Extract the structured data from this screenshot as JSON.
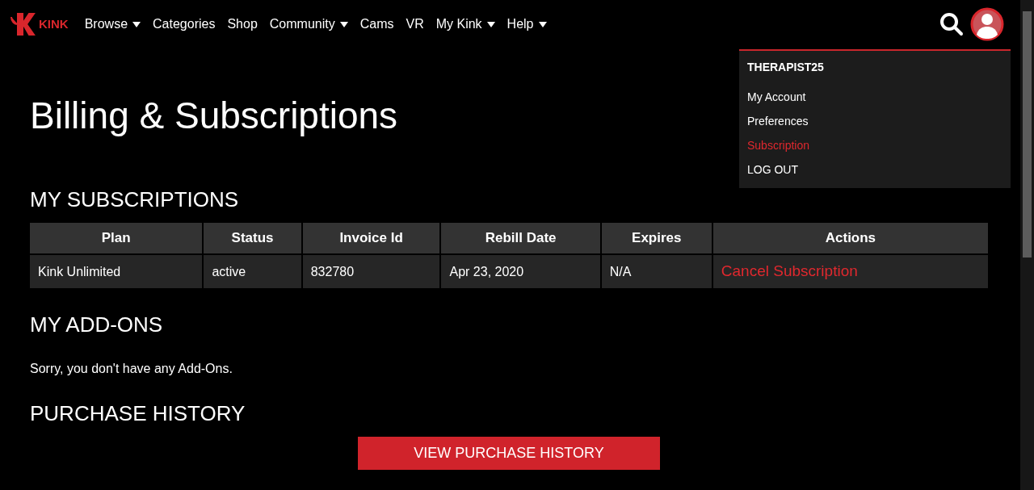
{
  "logo": {
    "text": "KINK"
  },
  "nav": [
    {
      "label": "Browse",
      "dropdown": true
    },
    {
      "label": "Categories",
      "dropdown": false
    },
    {
      "label": "Shop",
      "dropdown": false
    },
    {
      "label": "Community",
      "dropdown": true
    },
    {
      "label": "Cams",
      "dropdown": false
    },
    {
      "label": "VR",
      "dropdown": false
    },
    {
      "label": "My Kink",
      "dropdown": true
    },
    {
      "label": "Help",
      "dropdown": true
    }
  ],
  "user_menu": {
    "username": "THERAPIST25",
    "items": [
      {
        "label": "My Account",
        "selected": false
      },
      {
        "label": "Preferences",
        "selected": false
      },
      {
        "label": "Subscription",
        "selected": true
      },
      {
        "label": "LOG OUT",
        "selected": false
      }
    ]
  },
  "title": "Billing & Subscriptions",
  "subscriptions": {
    "heading": "MY SUBSCRIPTIONS",
    "columns": [
      "Plan",
      "Status",
      "Invoice Id",
      "Rebill Date",
      "Expires",
      "Actions"
    ],
    "rows": [
      {
        "cells": [
          "Kink Unlimited",
          "active",
          "832780",
          "Apr 23, 2020",
          "N/A"
        ],
        "action": "Cancel Subscription"
      }
    ]
  },
  "addons": {
    "heading": "MY ADD-ONS",
    "message": "Sorry, you don't have any Add-Ons."
  },
  "purchase_history": {
    "heading": "PURCHASE HISTORY",
    "button": "VIEW PURCHASE HISTORY"
  }
}
